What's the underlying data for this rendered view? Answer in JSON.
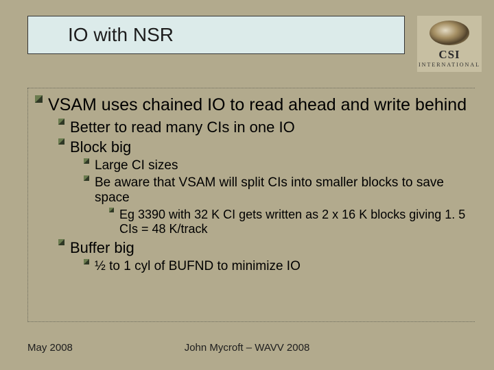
{
  "title": "IO with NSR",
  "logo": {
    "main": "CSI",
    "sub": "INTERNATIONAL"
  },
  "bullets": {
    "l1": "VSAM uses chained IO to read ahead and write behind",
    "l2a": "Better to read many CIs in one IO",
    "l2b": "Block big",
    "l3a": "Large CI sizes",
    "l3b": "Be aware that VSAM will split CIs into smaller blocks to save space",
    "l4a": "Eg 3390 with 32 K CI gets written as 2 x 16 K blocks giving 1. 5 CIs = 48 K/track",
    "l2c": "Buffer big",
    "l3c": "½ to 1 cyl of BUFND to minimize IO"
  },
  "footer": {
    "left": "May 2008",
    "center": "John Mycroft – WAVV 2008"
  }
}
